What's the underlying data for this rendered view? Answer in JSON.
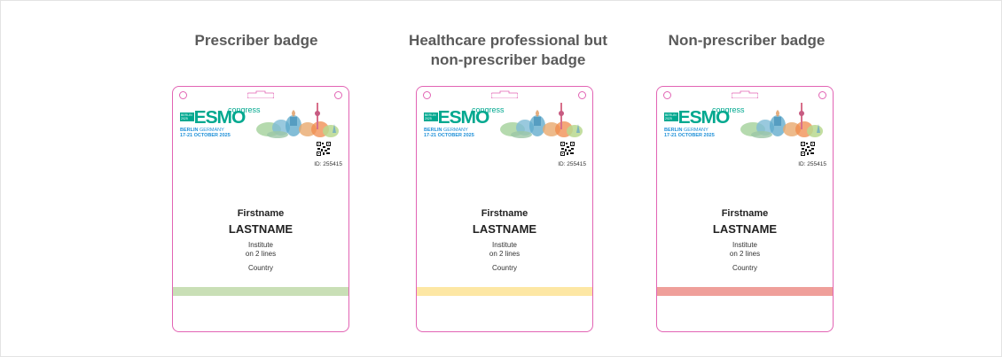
{
  "badges": [
    {
      "title": "Prescriber badge",
      "stripe_color": "#c9dfb6",
      "logo_tag": "BERLIN 2025",
      "logo_main": "ESMO",
      "logo_sub": "congress",
      "location_bold": "BERLIN",
      "location_thin": " GERMANY",
      "dates": "17-21 OCTOBER 2025",
      "id_text": "ID: 255415",
      "firstname": "Firstname",
      "lastname": "LASTNAME",
      "institute_line1": "Institute",
      "institute_line2": "on 2 lines",
      "country": "Country"
    },
    {
      "title": "Healthcare professional but non-prescriber badge",
      "stripe_color": "#fde7a4",
      "logo_tag": "BERLIN 2025",
      "logo_main": "ESMO",
      "logo_sub": "congress",
      "location_bold": "BERLIN",
      "location_thin": " GERMANY",
      "dates": "17-21 OCTOBER 2025",
      "id_text": "ID: 255415",
      "firstname": "Firstname",
      "lastname": "LASTNAME",
      "institute_line1": "Institute",
      "institute_line2": "on 2 lines",
      "country": "Country"
    },
    {
      "title": "Non-prescriber badge",
      "stripe_color": "#ef9f9a",
      "logo_tag": "BERLIN 2025",
      "logo_main": "ESMO",
      "logo_sub": "congress",
      "location_bold": "BERLIN",
      "location_thin": " GERMANY",
      "dates": "17-21 OCTOBER 2025",
      "id_text": "ID: 255415",
      "firstname": "Firstname",
      "lastname": "LASTNAME",
      "institute_line1": "Institute",
      "institute_line2": "on 2 lines",
      "country": "Country"
    }
  ],
  "colors": {
    "badge_border": "#e264b4",
    "esmo_green": "#00a88f",
    "berlin_blue": "#1e90d8"
  }
}
